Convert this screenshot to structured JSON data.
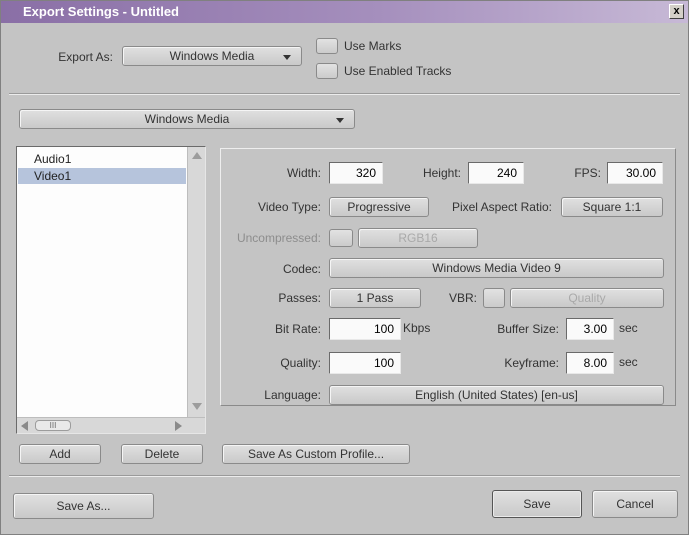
{
  "window": {
    "title": "Export Settings - Untitled",
    "close_label": "x"
  },
  "export_as": {
    "label": "Export As:",
    "value": "Windows Media"
  },
  "options": {
    "use_marks": "Use Marks",
    "use_enabled_tracks": "Use Enabled Tracks"
  },
  "format_dropdown": {
    "value": "Windows Media"
  },
  "tracks": {
    "items": [
      "Audio1",
      "Video1"
    ],
    "selected": "Video1",
    "hscroll_thumb": "III"
  },
  "settings": {
    "width_label": "Width:",
    "width_value": "320",
    "height_label": "Height:",
    "height_value": "240",
    "fps_label": "FPS:",
    "fps_value": "30.00",
    "video_type_label": "Video Type:",
    "video_type_value": "Progressive",
    "pixel_aspect_label": "Pixel Aspect Ratio:",
    "pixel_aspect_value": "Square 1:1",
    "uncompressed_label": "Uncompressed:",
    "uncompressed_value": "RGB16",
    "codec_label": "Codec:",
    "codec_value": "Windows Media Video 9",
    "passes_label": "Passes:",
    "passes_value": "1 Pass",
    "vbr_label": "VBR:",
    "vbr_value": "Quality",
    "bitrate_label": "Bit Rate:",
    "bitrate_value": "100",
    "bitrate_unit": "Kbps",
    "buffer_label": "Buffer Size:",
    "buffer_value": "3.00",
    "buffer_unit": "sec",
    "quality_label": "Quality:",
    "quality_value": "100",
    "keyframe_label": "Keyframe:",
    "keyframe_value": "8.00",
    "keyframe_unit": "sec",
    "language_label": "Language:",
    "language_value": "English (United States) [en-us]"
  },
  "actions": {
    "add": "Add",
    "delete": "Delete",
    "save_custom_profile": "Save As Custom Profile...",
    "save_as": "Save As...",
    "save": "Save",
    "cancel": "Cancel"
  }
}
